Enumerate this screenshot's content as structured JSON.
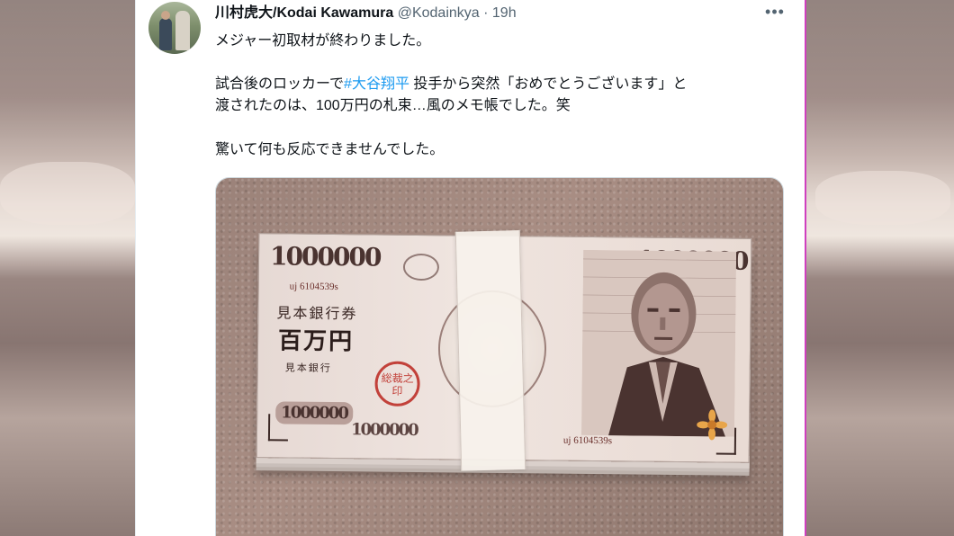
{
  "tweet": {
    "author_name": "川村虎大/Kodai Kawamura",
    "handle_time": " @Kodainkya · 19h",
    "more_icon": "more-horizontal-icon",
    "lines": [
      "メジャー初取材が終わりました。",
      "試合後のロッカーで",
      "#大谷翔平",
      " 投手から突然「おめでとうございます」と",
      "渡されたのは、100万円の札束…風のメモ帳でした。笑",
      "驚いて何も反応できませんでした。"
    ]
  },
  "media": {
    "note": {
      "denomination": "1000000",
      "serial": "uj 6104539s",
      "bank_name": "見本銀行券",
      "amount_kanji": "百万円",
      "issuer": "見本銀行",
      "seal_text": "総裁之印"
    }
  },
  "colors": {
    "link": "#1d9bf0",
    "text": "#0f1419",
    "secondary": "#536471",
    "frame_accent": "#cf3fbf"
  }
}
